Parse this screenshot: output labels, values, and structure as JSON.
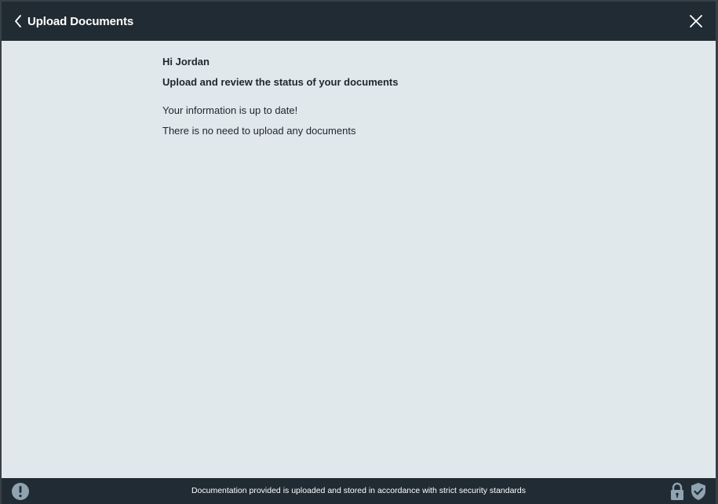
{
  "header": {
    "title": "Upload Documents"
  },
  "content": {
    "greeting": "Hi Jordan",
    "subtitle": "Upload and review the status of your documents",
    "status": "Your information is up to date!",
    "status_detail": "There is no need to upload any documents"
  },
  "footer": {
    "security_note": "Documentation provided is uploaded and stored in accordance with strict security standards"
  },
  "colors": {
    "header_bg": "#212b33",
    "content_bg": "#e1e8ec",
    "icon_muted": "#8fa3b0"
  }
}
